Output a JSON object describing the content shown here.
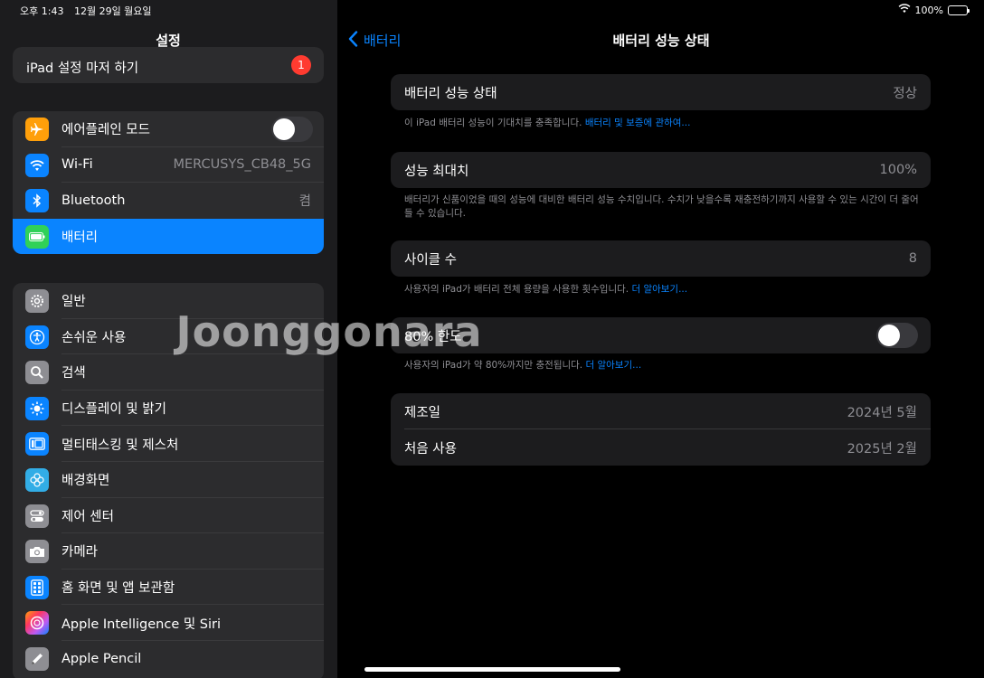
{
  "status": {
    "time": "오후 1:43",
    "date": "12월 29일 월요일",
    "battery": "100%"
  },
  "sidebar": {
    "title": "설정",
    "setup": {
      "label": "iPad 설정 마저 하기",
      "badge": "1"
    },
    "network": [
      {
        "label": "에어플레인 모드",
        "icon": "airplane-icon",
        "color": "#ff9f0a"
      },
      {
        "label": "Wi-Fi",
        "value": "MERCUSYS_CB48_5G",
        "icon": "wifi-icon",
        "color": "#0a84ff"
      },
      {
        "label": "Bluetooth",
        "value": "켬",
        "icon": "bluetooth-icon",
        "color": "#0a84ff"
      },
      {
        "label": "배터리",
        "icon": "battery-icon",
        "color": "#30d158"
      }
    ],
    "general": [
      {
        "label": "일반",
        "icon": "gear-icon",
        "color": "#8e8e93"
      },
      {
        "label": "손쉬운 사용",
        "icon": "accessibility-icon",
        "color": "#0a84ff"
      },
      {
        "label": "검색",
        "icon": "search-icon",
        "color": "#8e8e93"
      },
      {
        "label": "디스플레이 및 밝기",
        "icon": "brightness-icon",
        "color": "#0a84ff"
      },
      {
        "label": "멀티태스킹 및 제스처",
        "icon": "multitasking-icon",
        "color": "#0a84ff"
      },
      {
        "label": "배경화면",
        "icon": "wallpaper-icon",
        "color": "#32ade6"
      },
      {
        "label": "제어 센터",
        "icon": "control-center-icon",
        "color": "#8e8e93"
      },
      {
        "label": "카메라",
        "icon": "camera-icon",
        "color": "#8e8e93"
      },
      {
        "label": "홈 화면 및 앱 보관함",
        "icon": "home-screen-icon",
        "color": "#0a84ff"
      },
      {
        "label": "Apple Intelligence 및 Siri",
        "icon": "siri-icon",
        "color": "#bf5af2"
      },
      {
        "label": "Apple Pencil",
        "icon": "pencil-icon",
        "color": "#8e8e93"
      }
    ]
  },
  "main": {
    "back_label": "배터리",
    "title": "배터리 성능 상태",
    "health": {
      "label": "배터리 성능 상태",
      "value": "정상",
      "footer": "이 iPad 배터리 성능이 기대치를 충족합니다.",
      "footer_link": "배터리 및 보증에 관하여..."
    },
    "max": {
      "label": "성능 최대치",
      "value": "100%",
      "footer": "배터리가 신품이었을 때의 성능에 대비한 배터리 성능 수치입니다. 수치가 낮을수록 재충전하기까지 사용할 수 있는 시간이 더 줄어들 수 있습니다."
    },
    "cycles": {
      "label": "사이클 수",
      "value": "8",
      "footer": "사용자의 iPad가 배터리 전체 용량을 사용한 횟수입니다.",
      "footer_link": "더 알아보기..."
    },
    "limit": {
      "label": "80% 한도",
      "footer": "사용자의 iPad가 약 80%까지만 충전됩니다.",
      "footer_link": "더 알아보기..."
    },
    "dates": [
      {
        "label": "제조일",
        "value": "2024년 5월"
      },
      {
        "label": "처음 사용",
        "value": "2025년 2월"
      }
    ]
  },
  "watermark": "Joonggonara"
}
